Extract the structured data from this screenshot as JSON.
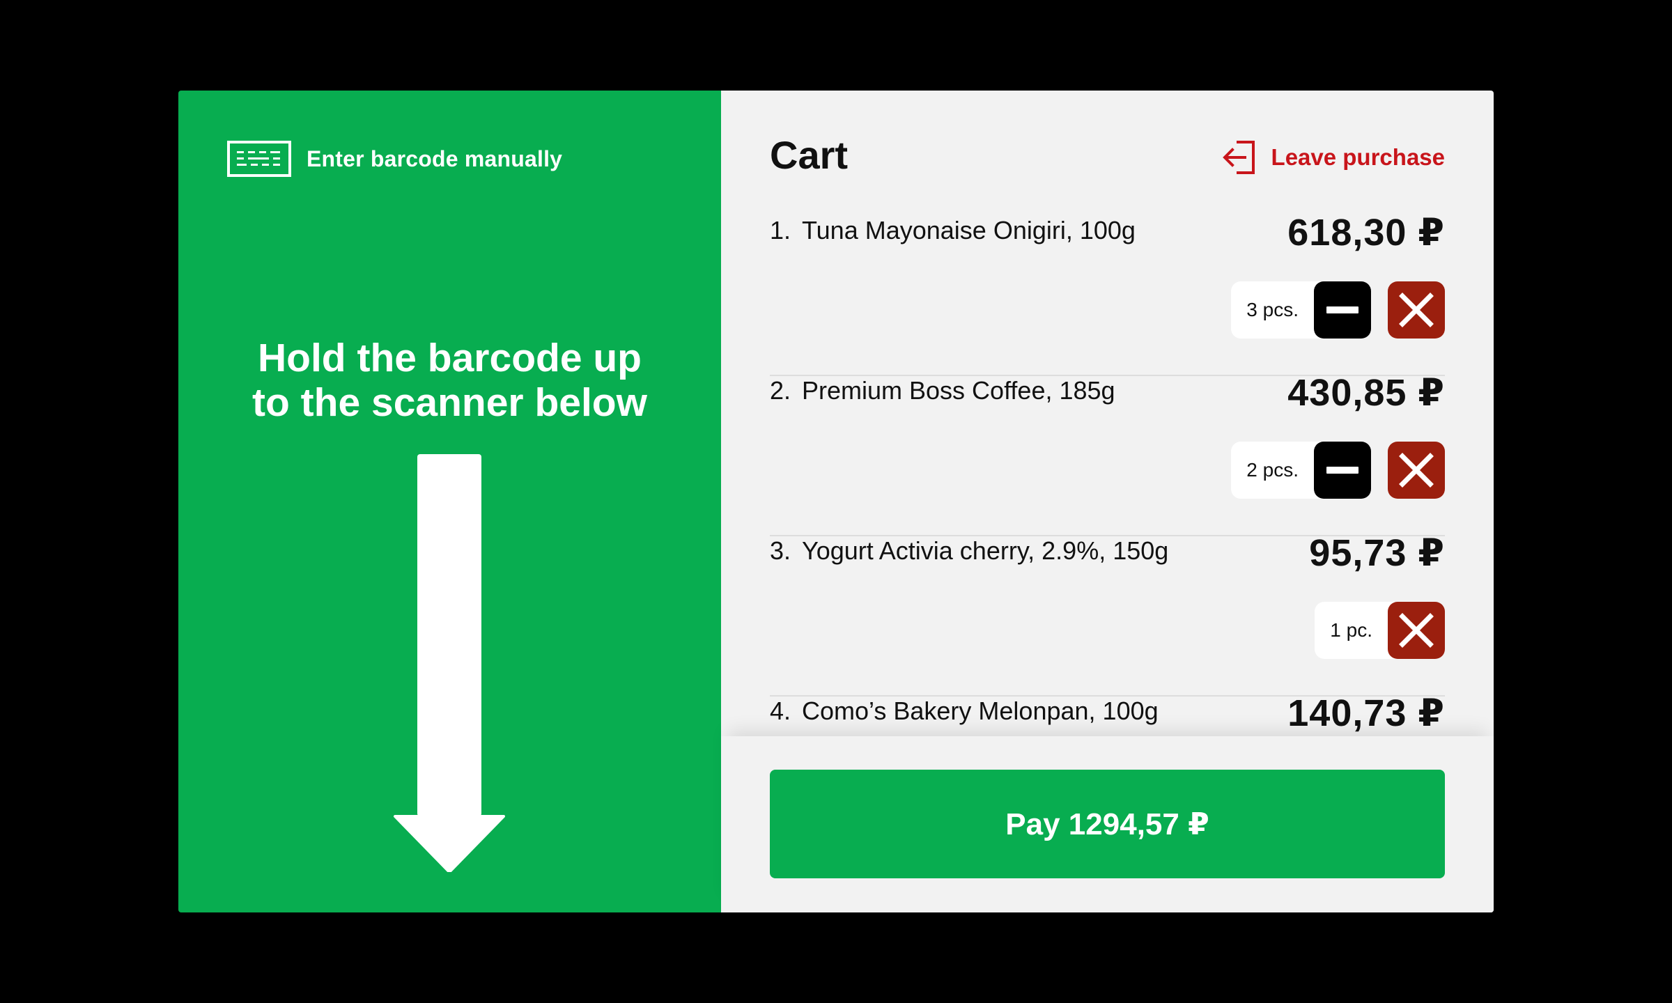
{
  "scan_panel": {
    "manual_entry_label": "Enter barcode manually",
    "manual_entry_icon": "keyboard-icon",
    "instruction_line1": "Hold the barcode up",
    "instruction_line2": "to the scanner below",
    "arrow_icon": "down-arrow-icon",
    "background_color": "#08AD50"
  },
  "cart": {
    "title": "Cart",
    "leave_label": "Leave purchase",
    "leave_icon": "exit-icon",
    "leave_color": "#C8151B",
    "items": [
      {
        "index": "1.",
        "name": "Tuna Mayonaise Onigiri, 100g",
        "price": "618,30 ₽",
        "quantity": "3 pcs.",
        "has_minus": true
      },
      {
        "index": "2.",
        "name": "Premium Boss Coffee, 185g",
        "price": "430,85 ₽",
        "quantity": "2 pcs.",
        "has_minus": true
      },
      {
        "index": "3.",
        "name": "Yogurt Activia cherry, 2.9%, 150g",
        "price": "95,73 ₽",
        "quantity": "1 pc.",
        "has_minus": false
      },
      {
        "index": "4.",
        "name": "Como’s Bakery Melonpan, 100g",
        "price": "140,73 ₽"
      }
    ],
    "pay_label": "Pay 1294,57 ₽",
    "remove_color": "#9B1F0E"
  }
}
